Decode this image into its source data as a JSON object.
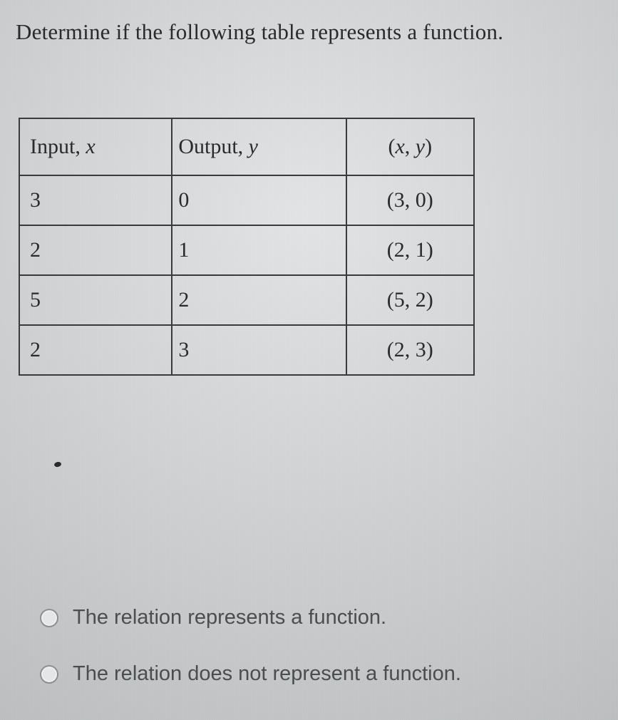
{
  "prompt": "Determine if the following table represents a function.",
  "table": {
    "headers": {
      "x": "Input, x",
      "y": "Output, y",
      "xy": "(x, y)"
    },
    "rows": [
      {
        "x": "3",
        "y": "0",
        "xy": "(3, 0)"
      },
      {
        "x": "2",
        "y": "1",
        "xy": "(2, 1)"
      },
      {
        "x": "5",
        "y": "2",
        "xy": "(5, 2)"
      },
      {
        "x": "2",
        "y": "3",
        "xy": "(2, 3)"
      }
    ]
  },
  "options": {
    "a": "The relation represents a function.",
    "b": "The relation does not represent a function."
  }
}
